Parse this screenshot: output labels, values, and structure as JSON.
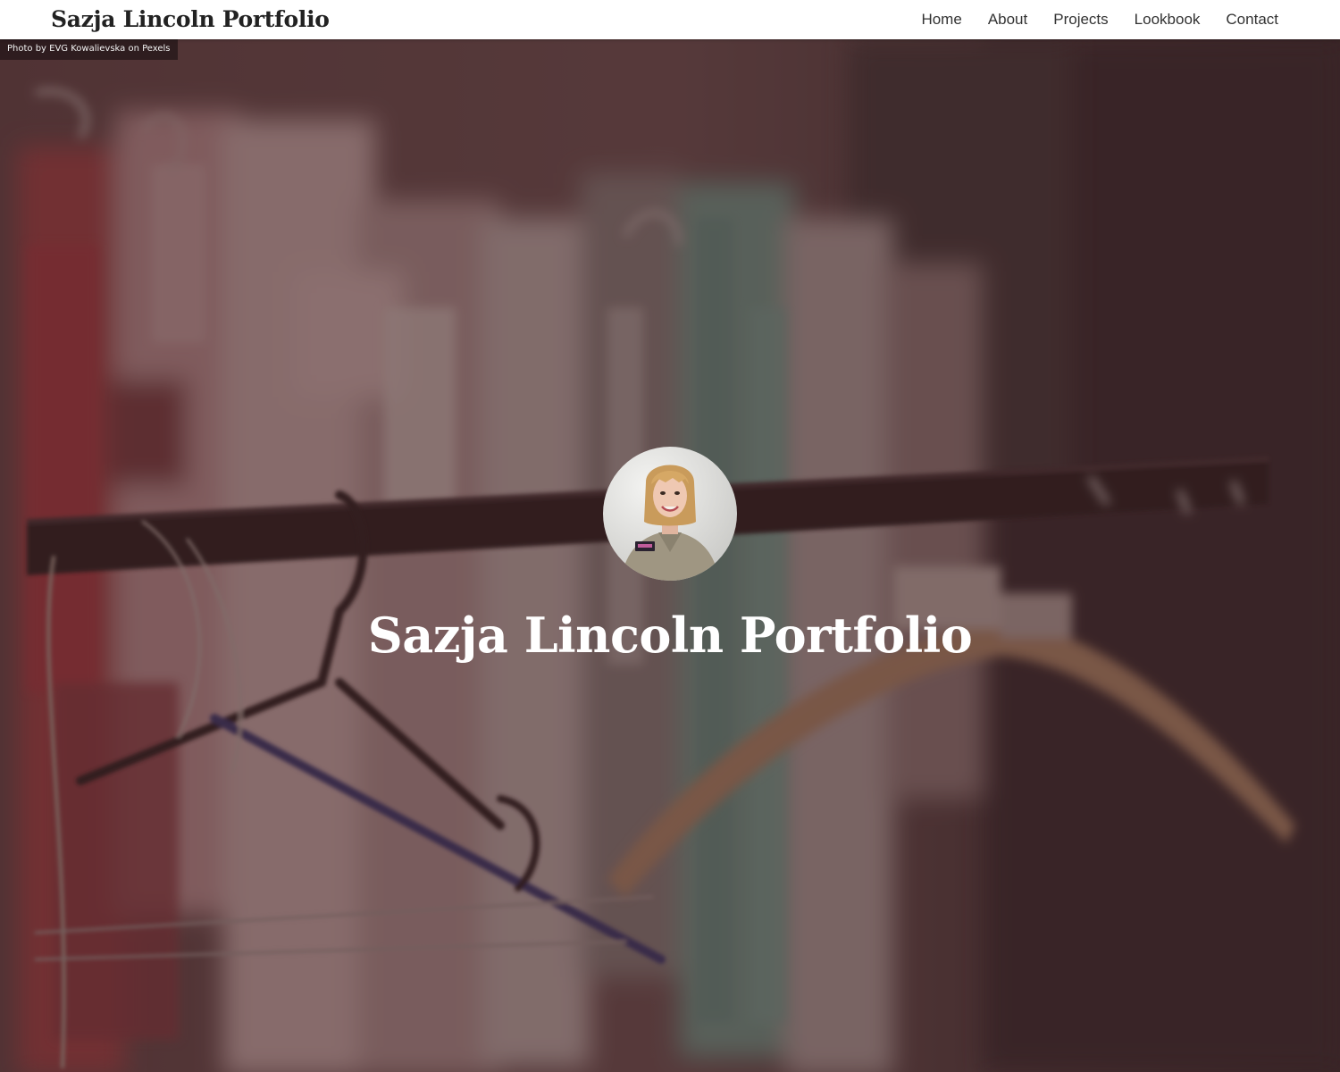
{
  "header": {
    "brand": "Sazja Lincoln Portfolio",
    "nav": [
      {
        "label": "Home"
      },
      {
        "label": "About"
      },
      {
        "label": "Projects"
      },
      {
        "label": "Lookbook"
      },
      {
        "label": "Contact"
      }
    ]
  },
  "hero": {
    "photo_credit": "Photo by EVG Kowalievska on Pexels",
    "title": "Sazja Lincoln Portfolio",
    "background_description_icon": "clothing-rack-photo",
    "avatar_icon": "profile-photo"
  },
  "colors": {
    "header_bg": "#ffffff",
    "brand_text": "#222222",
    "nav_text": "#333333",
    "hero_overlay": "#3c2224",
    "hero_title": "#ffffff"
  }
}
